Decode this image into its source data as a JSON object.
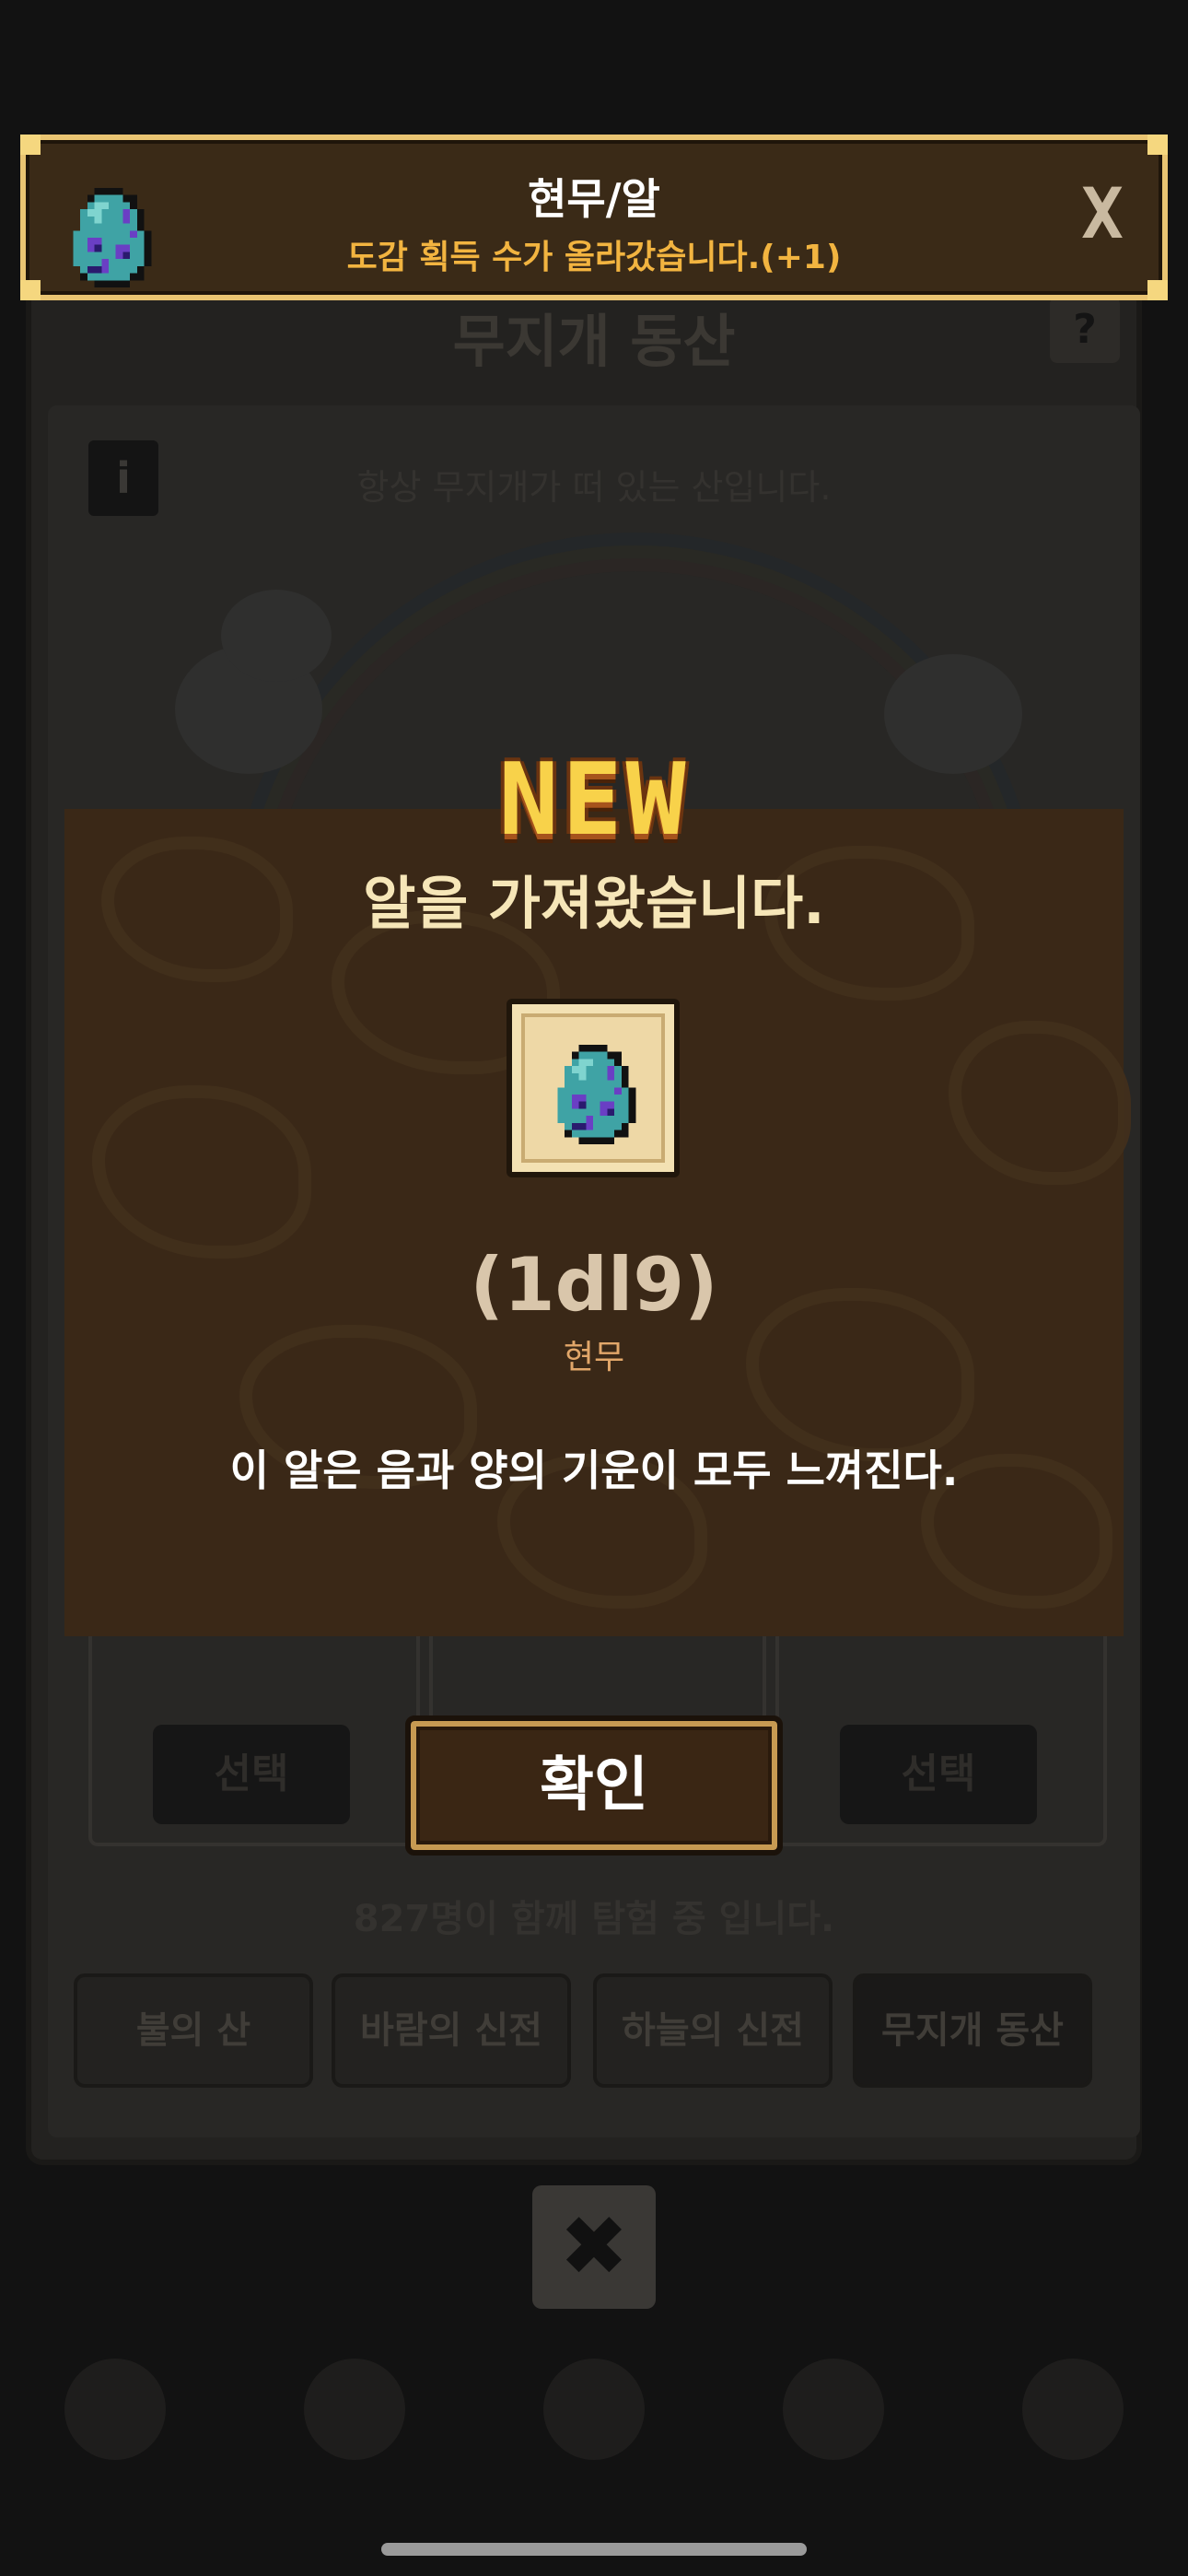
{
  "banner": {
    "title": "현무/알",
    "subtitle": "도감 획득 수가 올라갔습니다.(+1)",
    "close_label": "X",
    "icon": "egg-icon"
  },
  "background": {
    "title": "무지개 동산",
    "help_label": "?",
    "info_label": "i",
    "description": "항상 무지개가 떠 있는 산입니다.",
    "select_left": "선택",
    "select_right": "선택",
    "participants": "827명이 함께 탐험 중 입니다.",
    "tabs": [
      "불의 산",
      "바람의 신전",
      "하늘의 신전",
      "무지개 동산"
    ],
    "close_label": "✖"
  },
  "popup": {
    "new_label": "NEW",
    "heading": "알을 가져왔습니다.",
    "egg_id": "(1dl9)",
    "egg_name": "현무",
    "egg_description": "이 알은 음과 양의 기운이 모두 느껴진다.",
    "confirm_label": "확인"
  },
  "colors": {
    "accent_gold": "#f2b440",
    "banner_border": "#e9c472",
    "popup_bg": "#3a2817",
    "egg_teal": "#3fa3a5",
    "egg_purple": "#6a3fc4"
  }
}
